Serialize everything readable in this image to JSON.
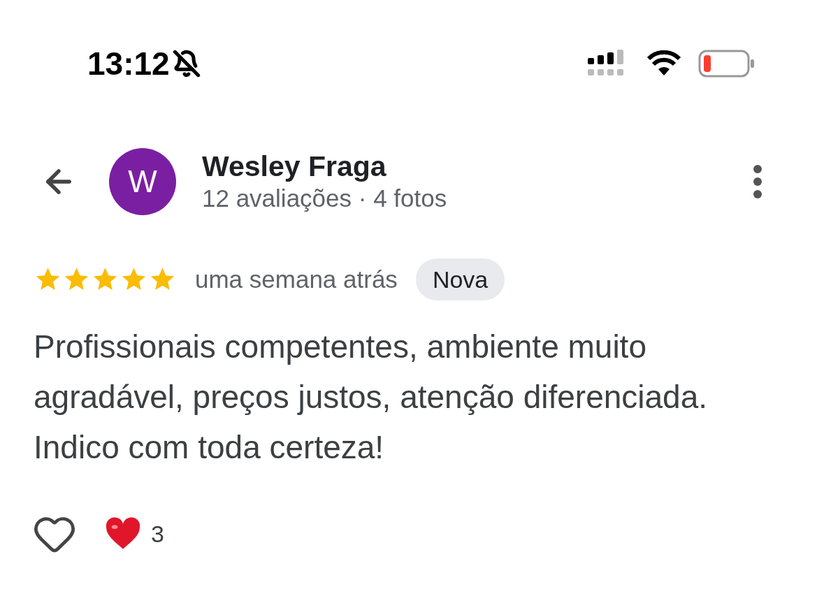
{
  "status_bar": {
    "time": "13:12"
  },
  "reviewer": {
    "name": "Wesley Fraga",
    "initial": "W",
    "color": "#7b1fa2",
    "meta": "12 avaliações · 4 fotos"
  },
  "review": {
    "stars": 5,
    "time": "uma semana atrás",
    "badge": "Nova",
    "text": "Profissionais competentes, ambiente muito agradável, preços justos, atenção diferenciada. Indico com toda certeza!"
  },
  "reactions": {
    "liked": false,
    "count": "3"
  }
}
